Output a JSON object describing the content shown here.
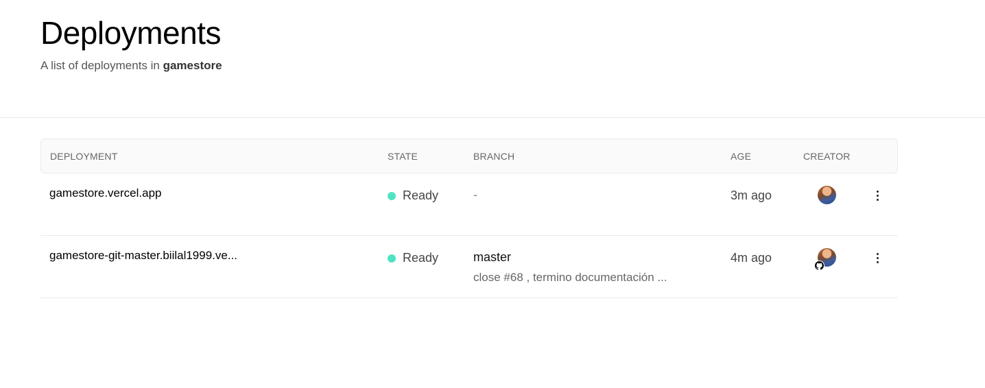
{
  "header": {
    "title": "Deployments",
    "subtitle_prefix": "A list of deployments in ",
    "project": "gamestore"
  },
  "table": {
    "columns": [
      "DEPLOYMENT",
      "STATE",
      "BRANCH",
      "AGE",
      "CREATOR"
    ],
    "rows": [
      {
        "deployment": "gamestore.vercel.app",
        "state": "Ready",
        "branch": "-",
        "commit": "",
        "age": "3m ago",
        "creator_icon": "avatar",
        "has_github_badge": false
      },
      {
        "deployment": "gamestore-git-master.biilal1999.ve...",
        "state": "Ready",
        "branch": "master",
        "commit": "close #68 , termino documentación ...",
        "age": "4m ago",
        "creator_icon": "avatar",
        "has_github_badge": true
      }
    ]
  },
  "colors": {
    "ready_dot": "#50e3c2",
    "divider": "#eaeaea",
    "header_bg": "#fafafa"
  }
}
